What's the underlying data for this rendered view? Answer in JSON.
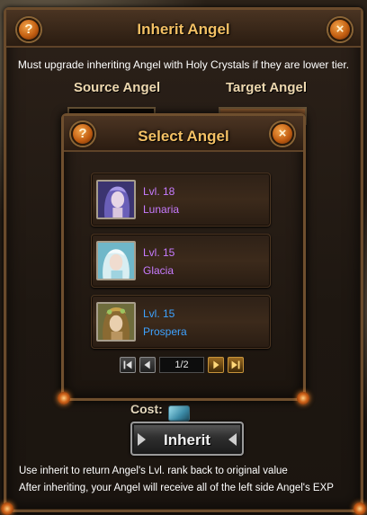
{
  "main_window": {
    "title": "Inherit Angel",
    "help_label": "?",
    "close_label": "×",
    "notice": "Must upgrade inheriting Angel with Holy Crystals if they are lower tier.",
    "source_label": "Source Angel",
    "target_label": "Target Angel",
    "cost_label": "Cost:",
    "inherit_button": "Inherit",
    "info_lines": [
      "Use inherit to return Angel's Lvl. rank back to original value",
      "After inheriting, your Angel will receive all of the left side Angel's EXP"
    ]
  },
  "select_dialog": {
    "title": "Select Angel",
    "help_label": "?",
    "close_label": "×",
    "angels": [
      {
        "level": "Lvl. 18",
        "name": "Lunaria",
        "color": "#c77bff",
        "portrait": "lunaria-portrait-icon"
      },
      {
        "level": "Lvl. 15",
        "name": "Glacia",
        "color": "#c77bff",
        "portrait": "glacia-portrait-icon"
      },
      {
        "level": "Lvl. 15",
        "name": "Prospera",
        "color": "#3ea2ff",
        "portrait": "prospera-portrait-icon"
      }
    ],
    "pager": {
      "page_text": "1/2",
      "first_icon": "first-page-icon",
      "prev_icon": "prev-page-icon",
      "next_icon": "next-page-icon",
      "last_icon": "last-page-icon"
    }
  },
  "colors": {
    "title_gold": "#f3c064",
    "purple_rarity": "#c77bff",
    "blue_rarity": "#3ea2ff",
    "frame_brown": "#6f4f2e"
  }
}
